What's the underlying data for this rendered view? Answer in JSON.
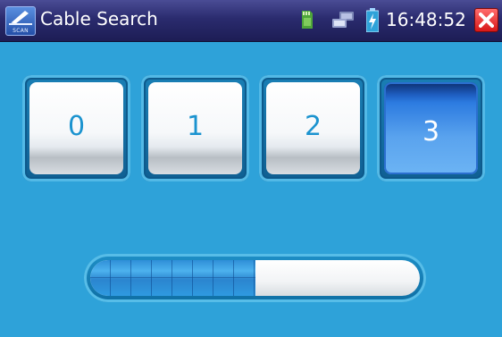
{
  "titlebar": {
    "title": "Cable Search",
    "app_icon_label": "SCAN",
    "time": "16:48:52",
    "icons": [
      "scan-app-icon",
      "sd-card-icon",
      "network-icon",
      "battery-charging-icon",
      "close-icon"
    ]
  },
  "pairs": [
    {
      "label": "0",
      "selected": false
    },
    {
      "label": "1",
      "selected": false
    },
    {
      "label": "2",
      "selected": false
    },
    {
      "label": "3",
      "selected": true
    }
  ],
  "progress": {
    "fraction": 0.5
  },
  "colors": {
    "titlebar": "#2a2b6e",
    "background": "#2ea2d9",
    "accent": "#1b93cf",
    "close": "#e02020"
  }
}
